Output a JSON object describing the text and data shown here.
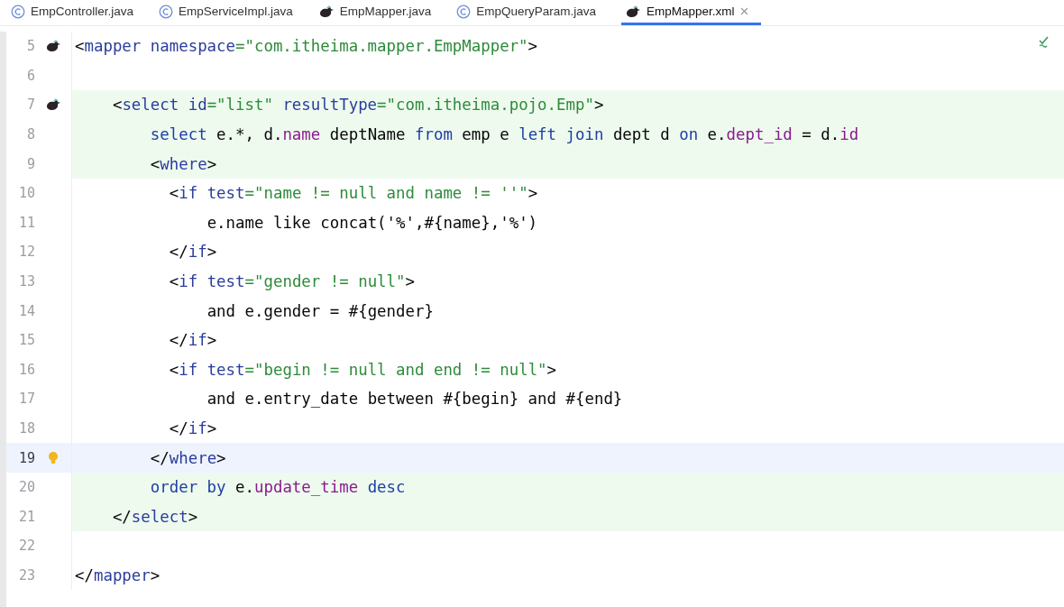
{
  "tabs": [
    {
      "label": "EmpController.java",
      "kind": "class",
      "selected": false
    },
    {
      "label": "EmpServiceImpl.java",
      "kind": "class",
      "selected": false
    },
    {
      "label": "EmpMapper.java",
      "kind": "mapper",
      "selected": false
    },
    {
      "label": "EmpQueryParam.java",
      "kind": "class",
      "selected": false
    },
    {
      "label": "EmpMapper.xml",
      "kind": "mapper",
      "selected": true
    }
  ],
  "editor": {
    "lines": [
      {
        "number": "5",
        "kind": "mapper",
        "added": false,
        "current": false,
        "tokens": [
          {
            "kind": "plain",
            "text": "<"
          },
          {
            "kind": "tag",
            "text": "mapper"
          },
          {
            "kind": "attr",
            "text": " namespace"
          },
          {
            "kind": "str",
            "text": "=\"com.itheima.mapper.EmpMapper\""
          },
          {
            "kind": "plain",
            "text": ">"
          }
        ]
      },
      {
        "number": "6",
        "kind": "plain",
        "added": false,
        "current": false
      },
      {
        "number": "7",
        "kind": "mapper",
        "added": true,
        "current": false,
        "tokens": [
          {
            "kind": "plain",
            "text": "    <"
          },
          {
            "kind": "tag",
            "text": "select"
          },
          {
            "kind": "attr",
            "text": " id"
          },
          {
            "kind": "str",
            "text": "=\"list\""
          },
          {
            "kind": "attr",
            "text": " resultType"
          },
          {
            "kind": "str",
            "text": "=\"com.itheima.pojo.Emp\""
          },
          {
            "kind": "plain",
            "text": ">"
          }
        ]
      },
      {
        "number": "8",
        "kind": "plain",
        "added": true,
        "current": false,
        "tokens": [
          {
            "kind": "kw",
            "text": "        select"
          },
          {
            "kind": "plain",
            "text": " e.*, d."
          },
          {
            "kind": "field",
            "text": "name"
          },
          {
            "kind": "plain",
            "text": " deptName "
          },
          {
            "kind": "kw",
            "text": "from"
          },
          {
            "kind": "plain",
            "text": " emp e "
          },
          {
            "kind": "kw",
            "text": "left join"
          },
          {
            "kind": "plain",
            "text": " dept d "
          },
          {
            "kind": "kw",
            "text": "on"
          },
          {
            "kind": "plain",
            "text": " e."
          },
          {
            "kind": "field",
            "text": "dept_id"
          },
          {
            "kind": "plain",
            "text": " = d."
          },
          {
            "kind": "field",
            "text": "id"
          }
        ]
      },
      {
        "number": "9",
        "kind": "plain",
        "added": true,
        "current": false,
        "tokens": [
          {
            "kind": "plain",
            "text": "        <"
          },
          {
            "kind": "tag",
            "text": "where"
          },
          {
            "kind": "plain",
            "text": ">"
          }
        ]
      },
      {
        "number": "10",
        "kind": "plain",
        "added": false,
        "current": false,
        "tokens": [
          {
            "kind": "plain",
            "text": "          <"
          },
          {
            "kind": "tag",
            "text": "if"
          },
          {
            "kind": "attr",
            "text": " test"
          },
          {
            "kind": "str",
            "text": "=\"name != null and name != ''\""
          },
          {
            "kind": "plain",
            "text": ">"
          }
        ]
      },
      {
        "number": "11",
        "kind": "plain",
        "added": false,
        "current": false,
        "tokens": [
          {
            "kind": "plain",
            "text": "              e.name like concat('%',#{name},'%')"
          }
        ]
      },
      {
        "number": "12",
        "kind": "plain",
        "added": false,
        "current": false,
        "tokens": [
          {
            "kind": "plain",
            "text": "          </"
          },
          {
            "kind": "tag",
            "text": "if"
          },
          {
            "kind": "plain",
            "text": ">"
          }
        ]
      },
      {
        "number": "13",
        "kind": "plain",
        "added": false,
        "current": false,
        "tokens": [
          {
            "kind": "plain",
            "text": "          <"
          },
          {
            "kind": "tag",
            "text": "if"
          },
          {
            "kind": "attr",
            "text": " test"
          },
          {
            "kind": "str",
            "text": "=\"gender != null\""
          },
          {
            "kind": "plain",
            "text": ">"
          }
        ]
      },
      {
        "number": "14",
        "kind": "plain",
        "added": false,
        "current": false,
        "tokens": [
          {
            "kind": "plain",
            "text": "              and e.gender = #{gender}"
          }
        ]
      },
      {
        "number": "15",
        "kind": "plain",
        "added": false,
        "current": false,
        "tokens": [
          {
            "kind": "plain",
            "text": "          </"
          },
          {
            "kind": "tag",
            "text": "if"
          },
          {
            "kind": "plain",
            "text": ">"
          }
        ]
      },
      {
        "number": "16",
        "kind": "plain",
        "added": false,
        "current": false,
        "tokens": [
          {
            "kind": "plain",
            "text": "          <"
          },
          {
            "kind": "tag",
            "text": "if"
          },
          {
            "kind": "attr",
            "text": " test"
          },
          {
            "kind": "str",
            "text": "=\"begin != null and end != null\""
          },
          {
            "kind": "plain",
            "text": ">"
          }
        ]
      },
      {
        "number": "17",
        "kind": "plain",
        "added": false,
        "current": false,
        "tokens": [
          {
            "kind": "plain",
            "text": "              and e.entry_date between #{begin} and #{end}"
          }
        ]
      },
      {
        "number": "18",
        "kind": "plain",
        "added": false,
        "current": false,
        "tokens": [
          {
            "kind": "plain",
            "text": "          </"
          },
          {
            "kind": "tag",
            "text": "if"
          },
          {
            "kind": "plain",
            "text": ">"
          }
        ]
      },
      {
        "number": "19",
        "kind": "intention",
        "added": false,
        "current": true,
        "tokens": [
          {
            "kind": "plain",
            "text": "        </"
          },
          {
            "kind": "tag",
            "text": "where"
          },
          {
            "kind": "plain",
            "text": ">"
          }
        ]
      },
      {
        "number": "20",
        "kind": "plain",
        "added": true,
        "current": false,
        "tokens": [
          {
            "kind": "kw",
            "text": "        order by"
          },
          {
            "kind": "plain",
            "text": " e."
          },
          {
            "kind": "field",
            "text": "update_time"
          },
          {
            "kind": "kw",
            "text": " desc"
          }
        ]
      },
      {
        "number": "21",
        "kind": "plain",
        "added": true,
        "current": false,
        "tokens": [
          {
            "kind": "plain",
            "text": "    </"
          },
          {
            "kind": "tag",
            "text": "select"
          },
          {
            "kind": "plain",
            "text": ">"
          }
        ]
      },
      {
        "number": "22",
        "kind": "plain",
        "added": false,
        "current": false
      },
      {
        "number": "23",
        "kind": "plain",
        "added": false,
        "current": false,
        "tokens": [
          {
            "kind": "plain",
            "text": "</"
          },
          {
            "kind": "tag",
            "text": "mapper"
          },
          {
            "kind": "plain",
            "text": ">"
          }
        ]
      }
    ]
  }
}
